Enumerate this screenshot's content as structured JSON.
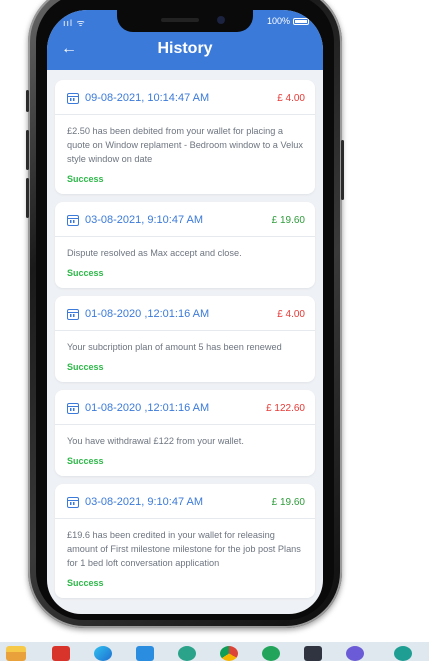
{
  "status_bar": {
    "signal": "ııl ᯤ",
    "battery": "100%"
  },
  "header": {
    "title": "History",
    "back": "←"
  },
  "transactions": [
    {
      "date": "09-08-2021, 10:14:47 AM",
      "amount": "£ 4.00",
      "description": "£2.50 has been debited from your wallet for placing a quote on Window replament - Bedroom window to a Velux style window on date",
      "status": "Success"
    },
    {
      "date": "03-08-2021, 9:10:47 AM",
      "amount": "£ 19.60",
      "description": "Dispute resolved as Max accept and close.",
      "status": "Success"
    },
    {
      "date": "01-08-2020 ,12:01:16 AM",
      "amount": "£ 4.00",
      "description": "Your subcription plan of amount 5 has been renewed",
      "status": "Success"
    },
    {
      "date": "01-08-2020 ,12:01:16 AM",
      "amount": "£ 122.60",
      "description": "You have withdrawal  £122 from your wallet.",
      "status": "Success"
    },
    {
      "date": "03-08-2021, 9:10:47 AM",
      "amount": "£ 19.60",
      "description": "£19.6 has been credited in your wallet for releasing amount of First milestone milestone for the job post Plans for 1 bed loft conversation application",
      "status": "Success"
    }
  ],
  "colors": {
    "primary": "#3b7ad9",
    "debit": "#e53935",
    "credit": "#2e9c3a",
    "success": "#2fb84a"
  },
  "taskbar_icons": [
    "file-explorer-icon",
    "app-red-icon",
    "edge-browser-icon",
    "vscode-icon",
    "app-green-icon",
    "chrome-icon",
    "app-green-circle-icon",
    "terminal-icon",
    "app-purple-icon",
    "app-teal-icon"
  ]
}
